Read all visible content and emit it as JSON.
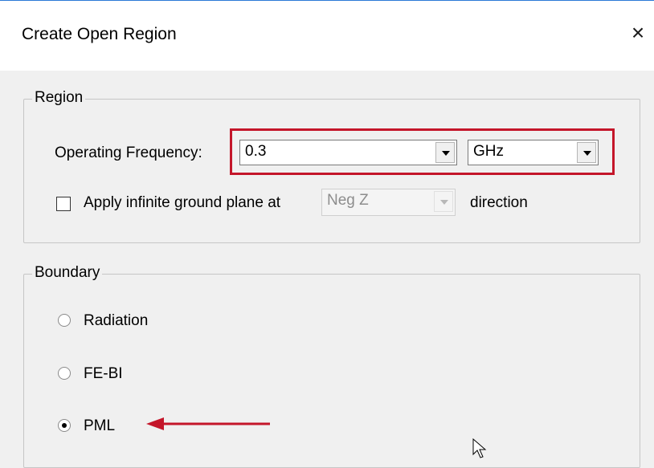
{
  "window": {
    "title": "Create Open Region",
    "close_glyph": "×"
  },
  "region": {
    "legend": "Region",
    "frequency_label": "Operating Frequency:",
    "frequency_value": "0.3",
    "unit_value": "GHz",
    "ground_plane_label": "Apply infinite ground plane at",
    "ground_plane_checked": false,
    "direction_value": "Neg Z",
    "direction_suffix": "direction"
  },
  "boundary": {
    "legend": "Boundary",
    "options": [
      {
        "label": "Radiation",
        "selected": false
      },
      {
        "label": "FE-BI",
        "selected": false
      },
      {
        "label": "PML",
        "selected": true
      }
    ]
  },
  "annotations": {
    "highlight_color": "#c4162a",
    "arrow_color": "#c4162a"
  }
}
